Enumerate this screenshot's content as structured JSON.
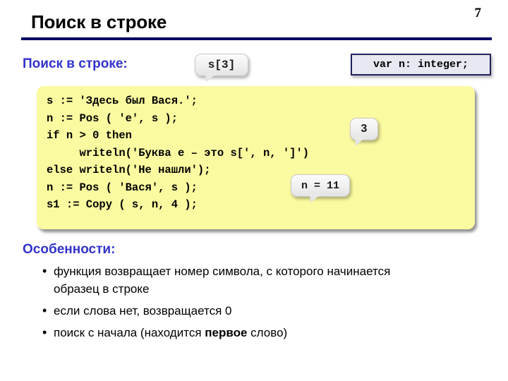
{
  "slide": {
    "page_number": "7",
    "title": "Поиск в строке",
    "subtitle": "Поиск в строке:",
    "features_heading": "Особенности:"
  },
  "callouts": {
    "index_bubble": "s[3]",
    "declaration_box": "var n: integer;",
    "result_three": "3",
    "result_n11": "n = 11"
  },
  "code": {
    "lines": [
      "s := 'Здесь был Вася.';",
      "n := Pos ( 'e', s );",
      "if n > 0 then",
      "     writeln('Буква е – это s[', n, ']')",
      "else writeln('Не нашли');",
      "n := Pos ( 'Вася', s );",
      "s1 := Copy ( s, n, 4 );"
    ]
  },
  "bullets": [
    {
      "marker": "•",
      "pre": "функция возвращает номер символа, с которого начинается образец в строке",
      "bold": "",
      "post": ""
    },
    {
      "marker": "•",
      "pre": "если слова нет, возвращается 0",
      "bold": "",
      "post": ""
    },
    {
      "marker": "•",
      "pre": "поиск с начала (находится ",
      "bold": "первое",
      "post": " слово)"
    }
  ],
  "colors": {
    "accent_blue": "#3333CC",
    "rule_navy": "#000066",
    "code_bg": "#FAFAA0",
    "decl_border": "#21215E",
    "decl_fill": "#E8E8F2"
  }
}
